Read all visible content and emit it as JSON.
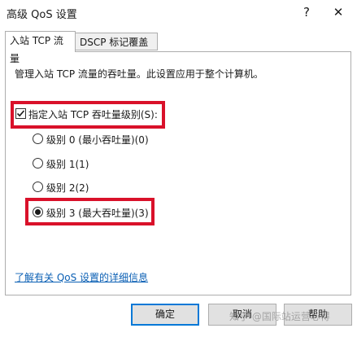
{
  "window": {
    "title": "高级 QoS 设置",
    "help_glyph": "?",
    "close_glyph": "✕"
  },
  "tabs": [
    {
      "label": "入站 TCP 流量",
      "active": true
    },
    {
      "label": "DSCP 标记覆盖",
      "active": false
    }
  ],
  "panel": {
    "description": "管理入站 TCP 流量的吞吐量。此设置应用于整个计算机。",
    "checkbox": {
      "label": "指定入站 TCP 吞吐量级别(S):",
      "checked": true
    },
    "radios": [
      {
        "label": "级别 0 (最小吞吐量)(0)",
        "selected": false
      },
      {
        "label": "级别 1(1)",
        "selected": false
      },
      {
        "label": "级别 2(2)",
        "selected": false
      },
      {
        "label": "级别 3 (最大吞吐量)(3)",
        "selected": true
      }
    ],
    "link": "了解有关 QoS 设置的详细信息"
  },
  "buttons": {
    "ok": "确定",
    "cancel": "取消",
    "help": "帮助"
  },
  "watermark": "知乎 @国际站运营心得",
  "colors": {
    "highlight": "#d9112a",
    "link": "#0a5fb4",
    "default_button_border": "#0078d7"
  }
}
